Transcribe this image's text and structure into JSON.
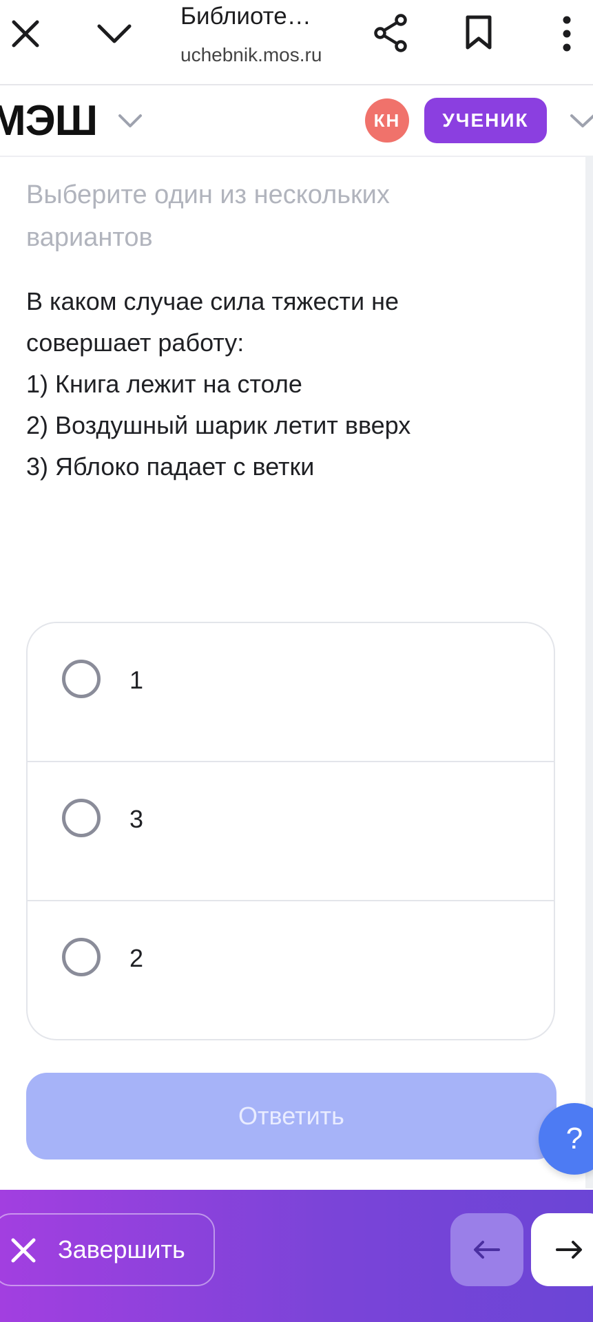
{
  "browser": {
    "title": "Библиоте…",
    "url": "uchebnik.mos.ru"
  },
  "header": {
    "logo": "МЭШ",
    "avatar_initials": "КН",
    "role_label": "УЧЕНИК"
  },
  "task": {
    "hint": "Выберите один из нескольких вариантов",
    "question_lines": [
      "В каком случае сила тяжести не",
      "совершает работу:",
      "1) Книга лежит на столе",
      "2) Воздушный шарик летит вверх",
      "3) Яблоко падает с ветки"
    ],
    "options": [
      "1",
      "3",
      "2"
    ],
    "submit_label": "Ответить"
  },
  "help": {
    "label": "?"
  },
  "footer": {
    "finish_label": "Завершить"
  },
  "colors": {
    "accent_purple": "#8b3fe0",
    "avatar_red": "#f0726b",
    "submit_disabled": "#a6b3f8",
    "help_blue": "#4d7bf3"
  },
  "icons": [
    "close-icon",
    "chevron-down-icon",
    "share-icon",
    "bookmark-icon",
    "more-vertical-icon",
    "arrow-left-icon",
    "arrow-right-icon"
  ]
}
